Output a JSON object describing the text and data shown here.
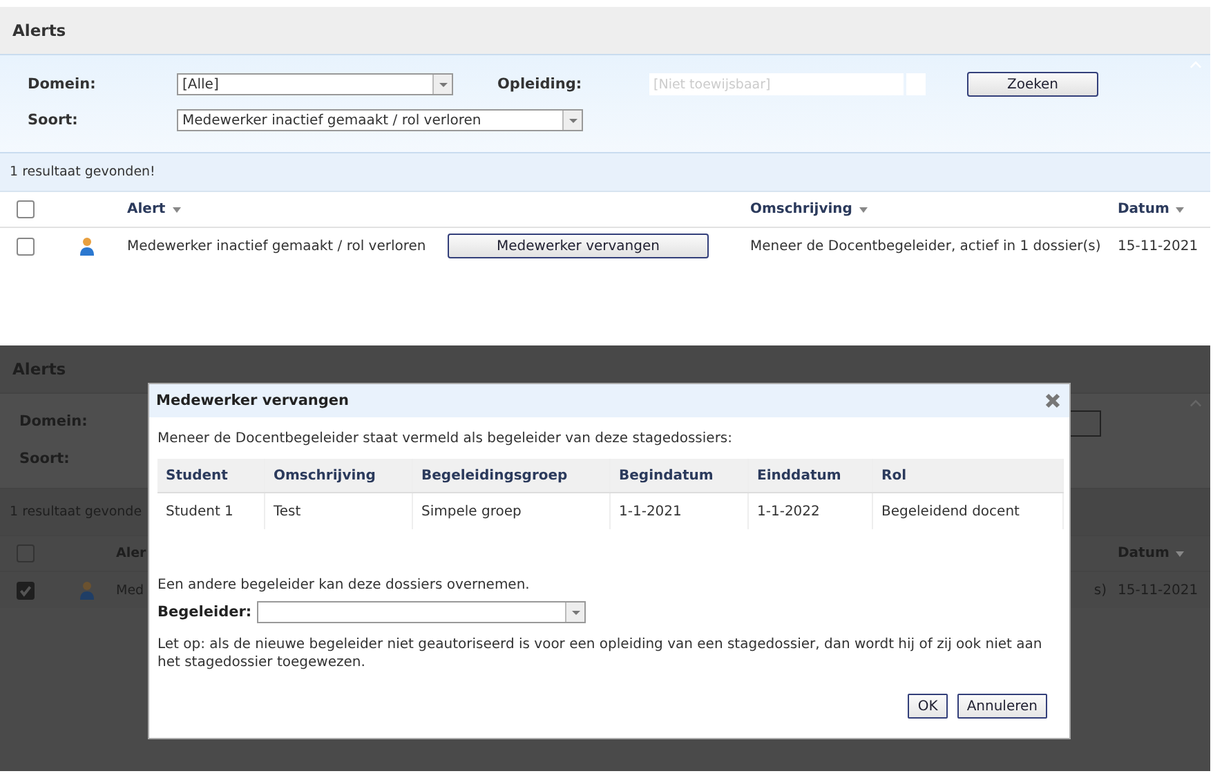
{
  "top": {
    "title": "Alerts",
    "domein": {
      "label": "Domein:",
      "value": "[Alle]"
    },
    "opleiding": {
      "label": "Opleiding:",
      "placeholder": "[Niet toewijsbaar]",
      "disabled": true
    },
    "soort": {
      "label": "Soort:",
      "value": "Medewerker inactief gemaakt / rol verloren"
    },
    "search_button": "Zoeken",
    "result_count": "1 resultaat gevonden!",
    "select_all_checked": false,
    "columns": [
      "Alert",
      "Omschrijving",
      "Datum"
    ],
    "rows": [
      {
        "checked": false,
        "alert": "Medewerker inactief gemaakt / rol verloren",
        "action": "Medewerker vervangen",
        "omschrijving": "Meneer de Docentbegeleider, actief in 1 dossier(s)",
        "datum": "15-11-2021"
      }
    ]
  },
  "bottom": {
    "background": {
      "title": "Alerts",
      "domein_label": "Domein:",
      "soort_label": "Soort:",
      "result_count": "1 resultaat gevonde",
      "select_all_checked": false,
      "columns": [
        "Aler",
        "Datum"
      ],
      "rows": [
        {
          "checked": true,
          "alert": "Med",
          "omschrijving": "s)",
          "datum": "15-11-2021"
        }
      ]
    },
    "dialog": {
      "title": "Medewerker vervangen",
      "intro": "Meneer de Docentbegeleider staat vermeld als begeleider van deze stagedossiers:",
      "columns": [
        "Student",
        "Omschrijving",
        "Begeleidingsgroep",
        "Begindatum",
        "Einddatum",
        "Rol"
      ],
      "rows": [
        [
          "Student 1",
          "Test",
          "Simpele groep",
          "1-1-2021",
          "1-1-2022",
          "Begeleidend docent"
        ]
      ],
      "note": "Een andere begeleider kan deze dossiers overnemen.",
      "begeleider_label": "Begeleider:",
      "warning": "Let op: als de nieuwe begeleider niet geautoriseerd is voor een opleiding van een stagedossier, dan wordt hij of zij ook niet aan het stagedossier toegewezen.",
      "buttons": [
        "OK",
        "Annuleren"
      ]
    }
  }
}
